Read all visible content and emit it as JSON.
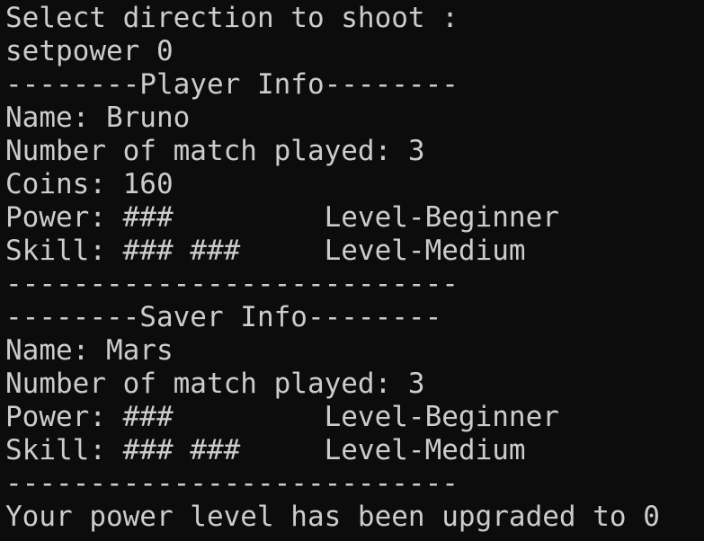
{
  "terminal": {
    "lines": [
      "Select direction to shoot :",
      "setpower 0",
      "--------Player Info--------",
      "Name: Bruno",
      "Number of match played: 3",
      "Coins: 160",
      "Power: ###         Level-Beginner",
      "Skill: ### ###     Level-Medium",
      "---------------------------",
      "--------Saver Info--------",
      "Name: Mars",
      "Number of match played: 3",
      "Power: ###         Level-Beginner",
      "Skill: ### ###     Level-Medium",
      "---------------------------",
      "Your power level has been upgraded to 0"
    ]
  }
}
